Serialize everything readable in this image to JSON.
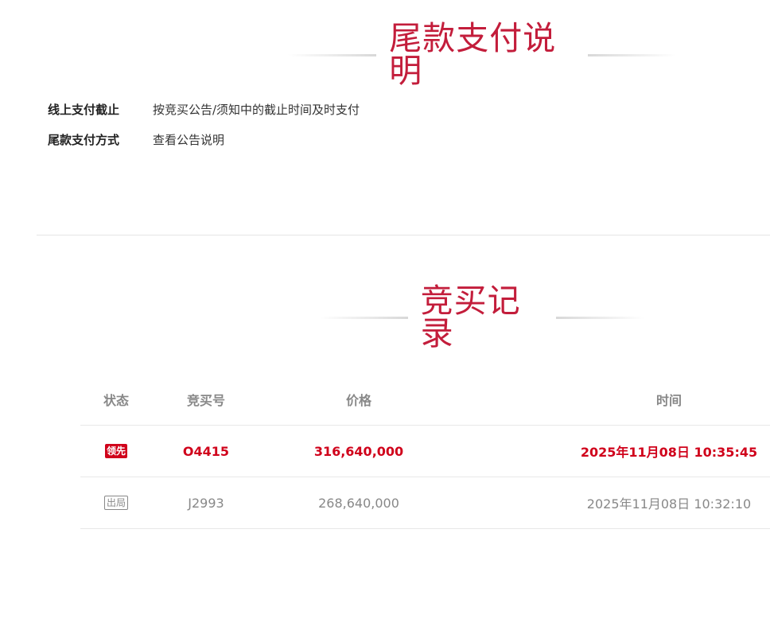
{
  "payment": {
    "title": "尾款支付说明",
    "deadline_label": "线上支付截止",
    "deadline_value": "按竞买公告/须知中的截止时间及时支付",
    "method_label": "尾款支付方式",
    "method_value": "查看公告说明"
  },
  "records": {
    "title": "竞买记录",
    "headers": {
      "status": "状态",
      "bid_no": "竞买号",
      "price": "价格",
      "time": "时间"
    },
    "rows": [
      {
        "status": "领先",
        "bid_no": "O4415",
        "price": "316,640,000",
        "time": "2025年11月08日 10:35:45"
      },
      {
        "status": "出局",
        "bid_no": "J2993",
        "price": "268,640,000",
        "time": "2025年11月08日 10:32:10"
      }
    ]
  },
  "colors": {
    "accent": "#c31d3b",
    "leading": "#d0021b",
    "muted": "#888888"
  }
}
